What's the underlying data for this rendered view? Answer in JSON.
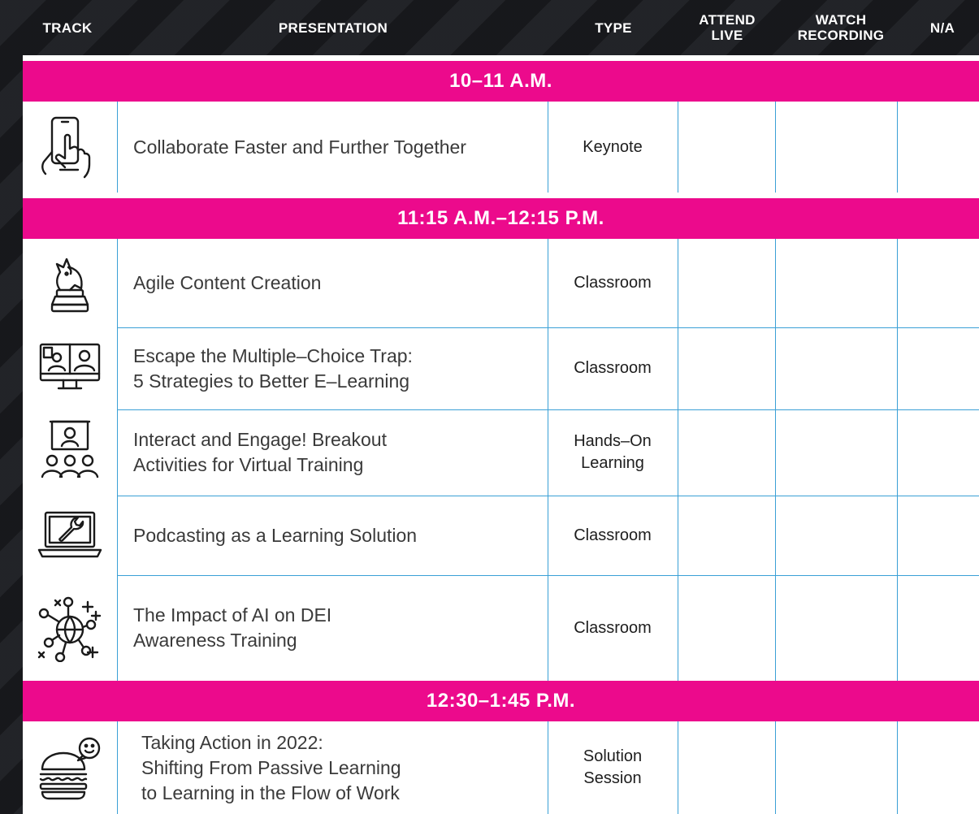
{
  "header": {
    "track": "TRACK",
    "presentation": "PRESENTATION",
    "type": "TYPE",
    "attend_line1": "ATTEND",
    "attend_line2": "LIVE",
    "watch_line1": "WATCH",
    "watch_line2": "RECORDING",
    "na": "N/A"
  },
  "slots": [
    {
      "label": "10–11 A.M."
    },
    {
      "label": "11:15 A.M.–12:15 P.M."
    },
    {
      "label": "12:30–1:45 P.M."
    }
  ],
  "sessions": [
    {
      "icon": "hand-phone-icon",
      "lines": [
        "Collaborate Faster and Further Together"
      ],
      "type": [
        "Keynote"
      ]
    },
    {
      "icon": "chess-knight-icon",
      "lines": [
        "Agile Content Creation"
      ],
      "type": [
        "Classroom"
      ]
    },
    {
      "icon": "video-call-monitor-icon",
      "lines": [
        "Escape the Multiple–Choice Trap:",
        "5 Strategies to Better E–Learning"
      ],
      "type": [
        "Classroom"
      ]
    },
    {
      "icon": "presenter-audience-icon",
      "lines": [
        "Interact and Engage! Breakout",
        "Activities for Virtual Training"
      ],
      "type": [
        "Hands–On",
        "Learning"
      ]
    },
    {
      "icon": "laptop-wrench-icon",
      "lines": [
        "Podcasting as a Learning Solution"
      ],
      "type": [
        "Classroom"
      ]
    },
    {
      "icon": "network-globe-icon",
      "lines": [
        "The Impact of AI on DEI",
        "Awareness Training"
      ],
      "type": [
        "Classroom"
      ]
    },
    {
      "icon": "burger-smiley-icon",
      "lines": [
        "Taking Action in 2022:",
        "Shifting From Passive Learning",
        "to Learning in the Flow of Work"
      ],
      "type": [
        "Solution",
        "Session"
      ]
    }
  ],
  "colors": {
    "accent": "#ec0a8c",
    "grid": "#3aa0d6",
    "background": "#1c1d21"
  }
}
